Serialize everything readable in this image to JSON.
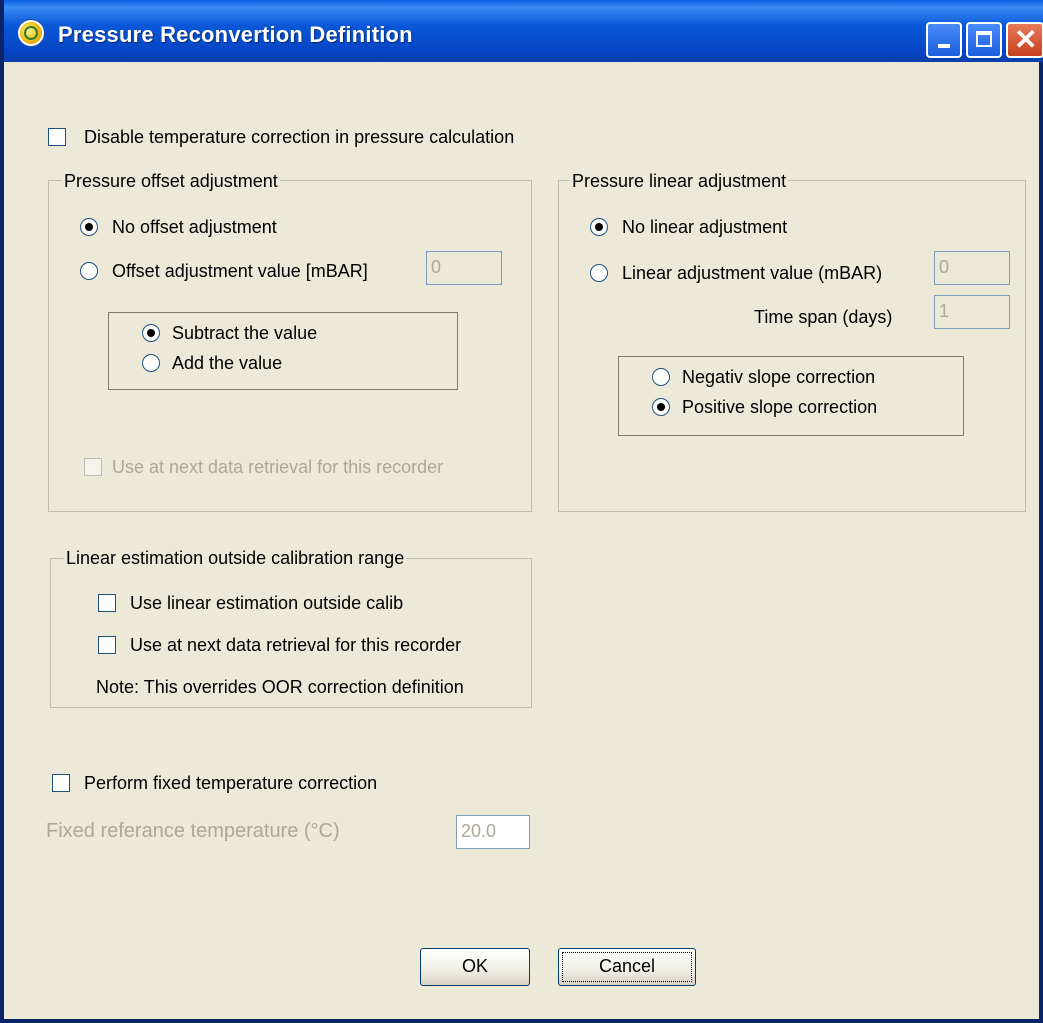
{
  "window": {
    "title": "Pressure Reconvertion Definition",
    "controls": [
      "minimize-icon",
      "maximize-icon",
      "close-icon"
    ]
  },
  "disable_temp_correction": {
    "label": "Disable temperature correction in pressure calculation",
    "checked": false
  },
  "offset_group": {
    "title": "Pressure offset adjustment",
    "no_offset_label": "No offset adjustment",
    "offset_value_label": "Offset adjustment value [mBAR]",
    "offset_value": "0",
    "subtract_label": "Subtract the value",
    "add_label": "Add the value",
    "use_next_label": "Use at next data retrieval for this recorder"
  },
  "linear_group": {
    "title": "Pressure linear adjustment",
    "no_linear_label": "No linear adjustment",
    "linear_value_label": "Linear adjustment value (mBAR)",
    "linear_value": "0",
    "time_span_label": "Time span (days)",
    "time_span_value": "1",
    "negative_label": "Negativ slope correction",
    "positive_label": "Positive slope correction"
  },
  "estimation_group": {
    "title": "Linear estimation outside calibration range",
    "use_linear_label": "Use linear estimation outside calib",
    "use_next_label": "Use at next data retrieval for this recorder",
    "note": "Note: This overrides OOR  correction definition"
  },
  "fixed_temp": {
    "label": "Perform fixed temperature correction",
    "ref_label": "Fixed referance temperature (°C)",
    "ref_value": "20.0"
  },
  "buttons": {
    "ok": "OK",
    "cancel": "Cancel"
  },
  "colors": {
    "titlebar": "#0a58d8",
    "dialog_bg": "#ece9d8",
    "disabled_text": "#aca899"
  }
}
